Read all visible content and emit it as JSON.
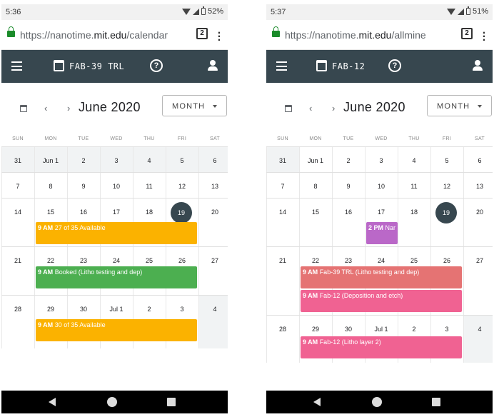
{
  "screens": [
    {
      "status": {
        "time": "5:36",
        "battery": "52%"
      },
      "browser": {
        "url_host": "https://nanotime.",
        "url_domain": "mit.edu",
        "url_path": "/calendar",
        "tab_count": "2"
      },
      "appbar": {
        "lab": "FAB-39 TRL",
        "help_symbol": "?"
      },
      "toolbar": {
        "prev": "‹",
        "next": "›",
        "month_title": "June 2020",
        "view_label": "MONTH"
      },
      "weekday_headers": [
        "SUN",
        "MON",
        "TUE",
        "WED",
        "THU",
        "FRI",
        "SAT"
      ],
      "weeks": [
        [
          "31",
          "Jun 1",
          "2",
          "3",
          "4",
          "5",
          "6"
        ],
        [
          "7",
          "8",
          "9",
          "10",
          "11",
          "12",
          "13"
        ],
        [
          "14",
          "15",
          "16",
          "17",
          "18",
          "19",
          "20"
        ],
        [
          "21",
          "22",
          "23",
          "24",
          "25",
          "26",
          "27"
        ],
        [
          "28",
          "29",
          "30",
          "Jul 1",
          "2",
          "3",
          "4"
        ]
      ],
      "today": "19",
      "events": [
        {
          "time": "9 AM",
          "text": "27 of 35 Available",
          "color": "#fbb200"
        },
        {
          "time": "9 AM",
          "text": "Booked (Litho testing and dep)",
          "color": "#4caf50"
        },
        {
          "time": "9 AM",
          "text": "30 of 35 Available",
          "color": "#fbb200"
        }
      ]
    },
    {
      "status": {
        "time": "5:37",
        "battery": "51%"
      },
      "browser": {
        "url_host": "https://nanotime.",
        "url_domain": "mit.edu",
        "url_path": "/allmine",
        "tab_count": "2"
      },
      "appbar": {
        "lab": "FAB-12",
        "help_symbol": "?"
      },
      "toolbar": {
        "prev": "‹",
        "next": "›",
        "month_title": "June 2020",
        "view_label": "MONTH"
      },
      "weekday_headers": [
        "SUN",
        "MON",
        "TUE",
        "WED",
        "THU",
        "FRI",
        "SAT"
      ],
      "weeks": [
        [
          "31",
          "Jun 1",
          "2",
          "3",
          "4",
          "5",
          "6"
        ],
        [
          "7",
          "8",
          "9",
          "10",
          "11",
          "12",
          "13"
        ],
        [
          "14",
          "15",
          "16",
          "17",
          "18",
          "19",
          "20"
        ],
        [
          "21",
          "22",
          "23",
          "24",
          "25",
          "26",
          "27"
        ],
        [
          "28",
          "29",
          "30",
          "Jul 1",
          "2",
          "3",
          "4"
        ]
      ],
      "today": "19",
      "events": [
        {
          "time": "2 PM",
          "text": "Nar",
          "color": "#ba68c8"
        },
        {
          "time": "9 AM",
          "text": "Fab-39 TRL (Litho testing and dep)",
          "color": "#e57373"
        },
        {
          "time": "9 AM",
          "text": "Fab-12 (Deposition and etch)",
          "color": "#f06292"
        },
        {
          "time": "9 AM",
          "text": "Fab-12 (Litho layer 2)",
          "color": "#f06292"
        }
      ]
    }
  ]
}
